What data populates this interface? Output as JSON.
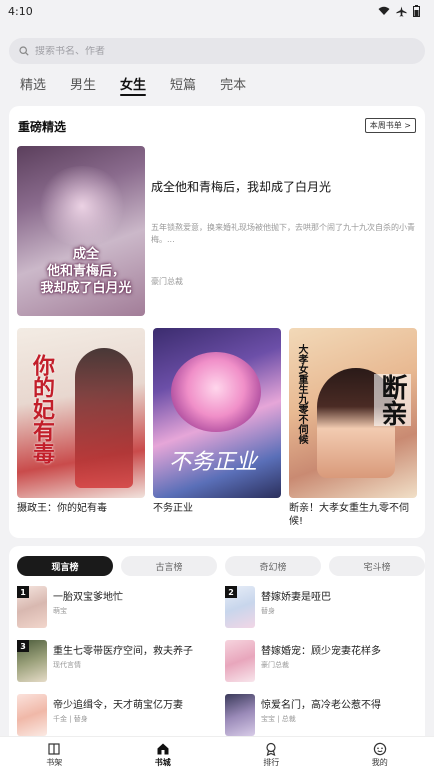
{
  "status_bar": {
    "time": "4:10"
  },
  "search": {
    "placeholder": "搜索书名、作者"
  },
  "tabs": [
    {
      "label": "精选"
    },
    {
      "label": "男生"
    },
    {
      "label": "女生"
    },
    {
      "label": "短篇"
    },
    {
      "label": "完本"
    }
  ],
  "active_tab": "女生",
  "featured_section": {
    "title": "重磅精选",
    "weekly_button": "本周书单 >",
    "main_book": {
      "cover_text": "成全\n他和青梅后，\n我却成了白月光",
      "title": "成全他和青梅后，我却成了白月光",
      "description": "五年锁熬爱意，换来婚礼现场被他抛下，去哄那个闹了九十九次自杀的小青梅。...",
      "author": "豪门总裁"
    },
    "books": [
      {
        "title": "摄政王：你的妃有毒",
        "cover_text": "你的妃有毒"
      },
      {
        "title": "不务正业",
        "cover_text": "不务正业"
      },
      {
        "title": "断亲！大孝女重生九零不伺候!",
        "cover_big": "断亲",
        "cover_small": "大孝女重生九零不伺候"
      }
    ]
  },
  "ranking": {
    "tabs": [
      "现言榜",
      "古言榜",
      "奇幻榜",
      "宅斗榜"
    ],
    "active": "现言榜",
    "items": [
      {
        "rank": "1",
        "title": "一胎双宝爹地忙",
        "author": "萌宝"
      },
      {
        "rank": "2",
        "title": "替嫁娇妻是哑巴",
        "author": "替身"
      },
      {
        "rank": "3",
        "title": "重生七零带医疗空间，救夫养子",
        "author": "现代言情"
      },
      {
        "rank": "",
        "title": "替嫁婚宠：顾少宠妻花样多",
        "author": "豪门总裁"
      },
      {
        "rank": "",
        "title": "帝少追缉令，天才萌宝亿万妻",
        "author": "千金 | 替身"
      },
      {
        "rank": "",
        "title": "惊爱名门，高冷老公惹不得",
        "author": "宝宝 | 总裁"
      }
    ]
  },
  "bottom_nav": [
    {
      "label": "书架",
      "icon": "book-open-icon"
    },
    {
      "label": "书城",
      "icon": "home-icon"
    },
    {
      "label": "排行",
      "icon": "ranking-icon"
    },
    {
      "label": "我的",
      "icon": "profile-icon"
    }
  ],
  "active_nav": "书城"
}
